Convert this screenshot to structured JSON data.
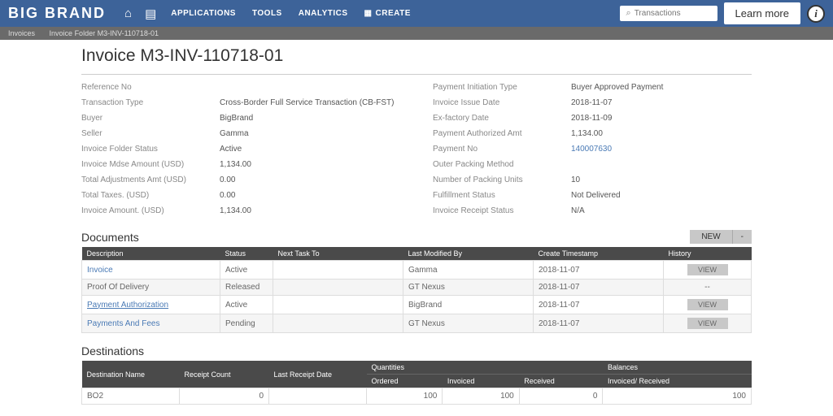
{
  "header": {
    "logo": "BIG BRAND",
    "nav": {
      "applications": "APPLICATIONS",
      "tools": "TOOLS",
      "analytics": "ANALYTICS",
      "create": "CREATE"
    },
    "search_placeholder": "Transactions",
    "learn_more": "Learn more"
  },
  "breadcrumb": {
    "invoices": "Invoices",
    "folder": "Invoice Folder M3-INV-110718-01"
  },
  "title": "Invoice M3-INV-110718-01",
  "left": [
    {
      "l": "Reference No",
      "v": ""
    },
    {
      "l": "Transaction Type",
      "v": "Cross-Border Full Service Transaction (CB-FST)"
    },
    {
      "l": "Buyer",
      "v": "BigBrand"
    },
    {
      "l": "Seller",
      "v": "Gamma"
    },
    {
      "l": "Invoice Folder Status",
      "v": "Active"
    },
    {
      "l": "Invoice Mdse Amount (USD)",
      "v": "1,134.00"
    },
    {
      "l": "Total Adjustments Amt (USD)",
      "v": "0.00"
    },
    {
      "l": "Total Taxes. (USD)",
      "v": "0.00"
    },
    {
      "l": "Invoice Amount. (USD)",
      "v": "1,134.00"
    }
  ],
  "right": [
    {
      "l": "Payment Initiation Type",
      "v": "Buyer Approved Payment"
    },
    {
      "l": "Invoice Issue Date",
      "v": "2018-11-07"
    },
    {
      "l": "Ex-factory Date",
      "v": "2018-11-09"
    },
    {
      "l": "Payment Authorized Amt",
      "v": "1,134.00"
    },
    {
      "l": "Payment No",
      "v": "140007630",
      "link": true
    },
    {
      "l": "Outer Packing Method",
      "v": ""
    },
    {
      "l": "Number of Packing Units",
      "v": "10"
    },
    {
      "l": "Fulfillment Status",
      "v": "Not Delivered"
    },
    {
      "l": "Invoice Receipt Status",
      "v": "N/A"
    }
  ],
  "docs": {
    "title": "Documents",
    "new": "NEW",
    "headers": {
      "desc": "Description",
      "status": "Status",
      "next": "Next Task To",
      "last": "Last Modified By",
      "create": "Create Timestamp",
      "history": "History"
    },
    "rows": [
      {
        "d": "Invoice",
        "s": "Active",
        "n": "",
        "m": "Gamma",
        "c": "2018-11-07",
        "h": "VIEW",
        "link": true
      },
      {
        "d": "Proof Of Delivery",
        "s": "Released",
        "n": "",
        "m": "GT Nexus",
        "c": "2018-11-07",
        "h": "--"
      },
      {
        "d": "Payment Authorization",
        "s": "Active",
        "n": "",
        "m": "BigBrand",
        "c": "2018-11-07",
        "h": "VIEW",
        "link": true,
        "ul": true
      },
      {
        "d": "Payments And Fees",
        "s": "Pending",
        "n": "",
        "m": "GT Nexus",
        "c": "2018-11-07",
        "h": "VIEW",
        "link": true
      }
    ]
  },
  "dest": {
    "title": "Destinations",
    "h1": {
      "name": "Destination Name",
      "rc": "Receipt Count",
      "lrd": "Last Receipt Date",
      "q": "Quantities",
      "b": "Balances"
    },
    "h2": {
      "ord": "Ordered",
      "inv": "Invoiced",
      "rec": "Received",
      "ir": "Invoiced/ Received"
    },
    "row": {
      "name": "BO2",
      "rc": "0",
      "lrd": "",
      "ord": "100",
      "inv": "100",
      "rec": "0",
      "ir": "100"
    }
  }
}
